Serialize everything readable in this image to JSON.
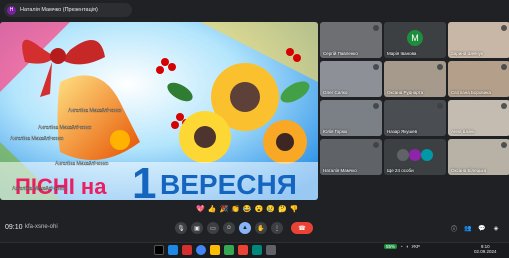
{
  "meeting": {
    "presenter_initial": "Н",
    "presenter_label": "Наталія Мамчко (Презентація)",
    "code": "kfa-xsne-ohi",
    "clock": "09:10"
  },
  "slide": {
    "title_small": "ПІСНІ на",
    "title_number": "1",
    "title_big": "ВЕРЕСНЯ",
    "overlay_name": "Ангеліна Михайліченко"
  },
  "participants": [
    {
      "name": "Сергій Павленко"
    },
    {
      "name": "Марія Іванова",
      "initial": "М"
    },
    {
      "name": "Зарина Шевчук"
    },
    {
      "name": "Олег Салко"
    },
    {
      "name": "Оксана Руднарта"
    },
    {
      "name": "Світлана Боровика"
    },
    {
      "name": "Юлія Горюк"
    },
    {
      "name": "Назар Якушев"
    },
    {
      "name": "Анна Шкінь"
    },
    {
      "name": "Наталія Мамчко"
    },
    {
      "name": "Ще 24 особи"
    },
    {
      "name": "Оксана Білецька"
    }
  ],
  "emoji": [
    "💖",
    "👍",
    "🎉",
    "👏",
    "😂",
    "😮",
    "😢",
    "🤔",
    "👎"
  ],
  "tray": {
    "battery": "55%",
    "lang": "УКР",
    "time": "9:10",
    "date": "02.09.2024"
  },
  "colors": {
    "accent": "#8ab4f8",
    "end_call": "#ea4335",
    "bell": "#f4b400",
    "ribbon": "#d32f2f"
  }
}
